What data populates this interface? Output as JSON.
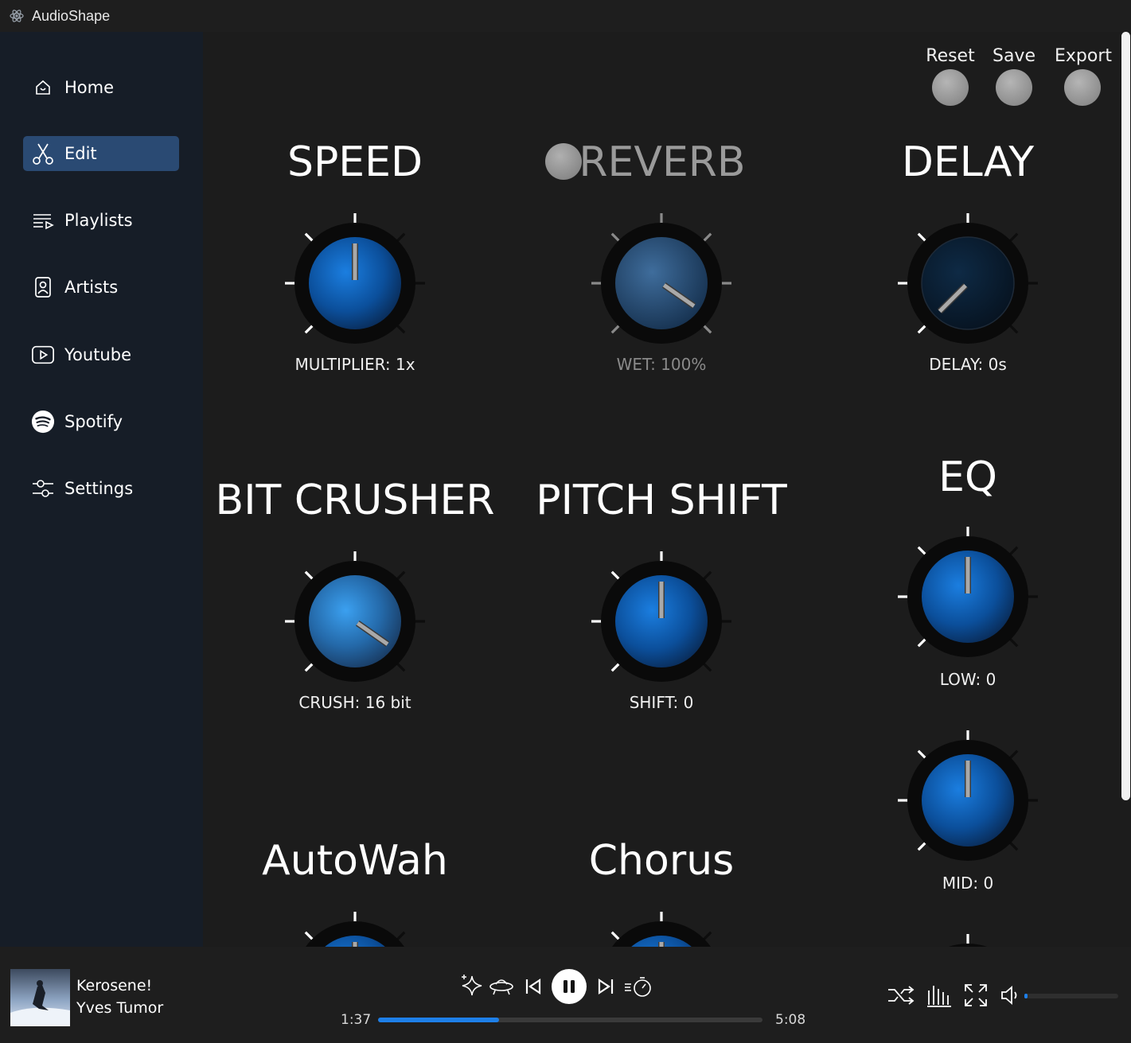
{
  "titlebar": {
    "app_title": "AudioShape",
    "icon": "atom-icon"
  },
  "sidebar": {
    "items": [
      {
        "label": "Home",
        "icon": "home-icon",
        "active": false
      },
      {
        "label": "Edit",
        "icon": "scissors-icon",
        "active": true
      },
      {
        "label": "Playlists",
        "icon": "playlist-icon",
        "active": false
      },
      {
        "label": "Artists",
        "icon": "artist-portrait-icon",
        "active": false
      },
      {
        "label": "Youtube",
        "icon": "youtube-play-icon",
        "active": false
      },
      {
        "label": "Spotify",
        "icon": "spotify-icon",
        "active": false
      },
      {
        "label": "Settings",
        "icon": "sliders-icon",
        "active": false
      }
    ]
  },
  "actions": {
    "reset": "Reset",
    "save": "Save",
    "export": "Export"
  },
  "effects": {
    "speed": {
      "title": "SPEED",
      "param": "MULTIPLIER: 1x",
      "knob_deg": 0
    },
    "reverb": {
      "title": "REVERB",
      "param": "WET: 100%",
      "enabled": false,
      "knob_deg": 125
    },
    "delay": {
      "title": "DELAY",
      "param": "DELAY: 0s",
      "knob_deg": -135
    },
    "bitcrusher": {
      "title": "BIT CRUSHER",
      "param": "CRUSH: 16 bit",
      "knob_deg": 125
    },
    "pitchshift": {
      "title": "PITCH SHIFT",
      "param": "SHIFT: 0",
      "knob_deg": 0
    },
    "eq": {
      "title": "EQ",
      "low": "LOW: 0",
      "mid": "MID: 0",
      "low_deg": 0,
      "mid_deg": 0
    },
    "autowah": {
      "title": "AutoWah"
    },
    "chorus": {
      "title": "Chorus"
    }
  },
  "player": {
    "track_title": "Kerosene!",
    "track_artist": "Yves Tumor",
    "elapsed": "1:37",
    "duration": "5:08",
    "progress_fraction": 0.315,
    "volume_fraction": 0.03,
    "accent_color": "#1e7fe8",
    "controls": [
      "sparkle-icon",
      "ufo-icon",
      "previous-icon",
      "pause-icon",
      "next-icon",
      "sleep-timer-icon",
      "shuffle-icon",
      "equalizer-icon",
      "fullscreen-icon",
      "volume-icon"
    ]
  }
}
